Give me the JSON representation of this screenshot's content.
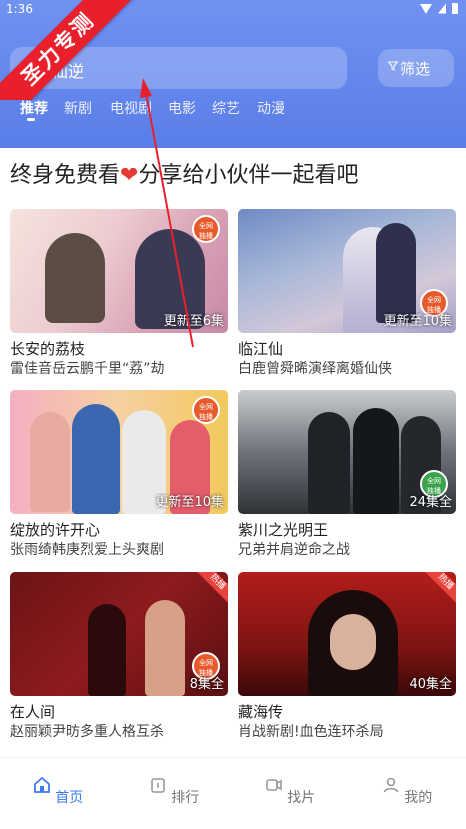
{
  "status_bar": {
    "time": "1:36"
  },
  "watermark": {
    "text": "圣力专测"
  },
  "search": {
    "value": "仙逆"
  },
  "filter_button": {
    "label": "筛选"
  },
  "tabs": [
    {
      "label": "推荐",
      "active": true
    },
    {
      "label": "新剧"
    },
    {
      "label": "电视剧"
    },
    {
      "label": "电影"
    },
    {
      "label": "综艺"
    },
    {
      "label": "动漫"
    }
  ],
  "headline": {
    "before": "终身免费看",
    "after": "分享给小伙伴一起看吧"
  },
  "cards": [
    {
      "title": "长安的荔枝",
      "desc": "雷佳音岳云鹏千里“荔”劫",
      "badge": "更新至6集",
      "corner_tag": "全网\n独播"
    },
    {
      "title": "临江仙",
      "desc": "白鹿曾舜晞演绎离婚仙侠",
      "badge": "更新至10集",
      "corner_tag": "全网\n独播"
    },
    {
      "title": "绽放的许开心",
      "desc": "张雨绮韩庚烈爱上头爽剧",
      "badge": "更新至10集",
      "corner_tag": "全网\n独播"
    },
    {
      "title": "紫川之光明王",
      "desc": "兄弟并肩逆命之战",
      "badge": "24集全",
      "corner_tag": "全网\n独播"
    },
    {
      "title": "在人间",
      "desc": "赵丽颖尹昉多重人格互杀",
      "badge": "8集全",
      "corner_tag": "全网\n独播",
      "hot": "热播"
    },
    {
      "title": "藏海传",
      "desc": "肖战新剧!血色连环杀局",
      "badge": "40集全",
      "hot": "热播"
    }
  ],
  "bottom_nav": [
    {
      "label": "首页",
      "icon": "home-icon",
      "active": true
    },
    {
      "label": "排行",
      "icon": "rank-icon"
    },
    {
      "label": "找片",
      "icon": "video-icon"
    },
    {
      "label": "我的",
      "icon": "user-icon"
    }
  ],
  "colors": {
    "header": "#6a8df0",
    "accent": "#3d7af0",
    "ribbon": "#e9202b"
  }
}
